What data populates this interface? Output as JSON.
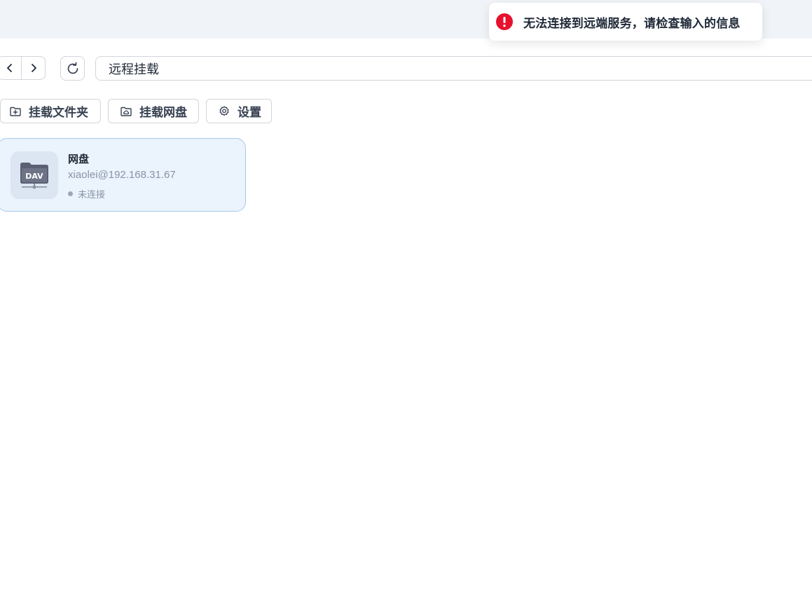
{
  "toast": {
    "message": "无法连接到远端服务，请检查输入的信息",
    "icon": "error-icon",
    "color": "#e8112d"
  },
  "toolbar": {
    "back_icon": "chevron-left-icon",
    "forward_icon": "chevron-right-icon",
    "refresh_icon": "refresh-icon",
    "path": "远程挂载"
  },
  "actions": {
    "mount_folder": "挂载文件夹",
    "mount_drive": "挂载网盘",
    "settings": "设置"
  },
  "mounts": [
    {
      "name": "网盘",
      "address": "xiaolei@192.168.31.67",
      "status": "未连接",
      "icon": "dav-folder-icon",
      "icon_label": "DAV"
    }
  ],
  "colors": {
    "accent_bg": "#ebf3fc",
    "accent_border": "#a9c7ea",
    "topbar": "#f0f3f8"
  }
}
